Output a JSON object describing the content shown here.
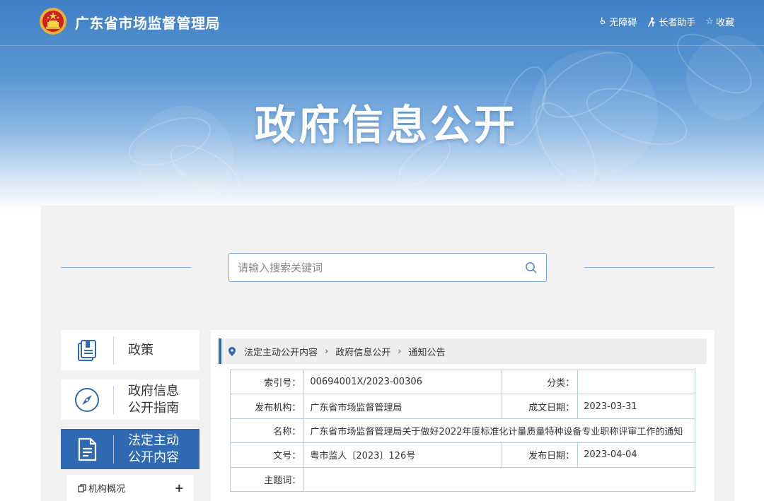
{
  "header": {
    "site_title": "广东省市场监督管理局",
    "links": [
      {
        "icon": "wheelchair-icon",
        "label": "无障碍"
      },
      {
        "icon": "elder-icon",
        "label": "长者助手"
      },
      {
        "icon": "star-icon",
        "label": "收藏"
      }
    ],
    "banner_title": "政府信息公开"
  },
  "search": {
    "placeholder": "请输入搜索关键词",
    "value": ""
  },
  "sidebar": {
    "items": [
      {
        "label": "政策",
        "icon": "book-icon",
        "active": false
      },
      {
        "label": "政府信息\n公开指南",
        "icon": "compass-icon",
        "active": false
      },
      {
        "label": "法定主动\n公开内容",
        "icon": "document-icon",
        "active": true
      }
    ],
    "sub_items": [
      {
        "label": "机构概况",
        "icon": "copy-icon",
        "expand": "+"
      }
    ]
  },
  "breadcrumb": {
    "items": [
      "法定主动公开内容",
      "政府信息公开",
      "通知公告"
    ]
  },
  "meta": {
    "index_label": "索引号：",
    "index_value": "00694001X/2023-00306",
    "category_label": "分类：",
    "category_value": "",
    "publisher_label": "发布机构：",
    "publisher_value": "广东省市场监督管理局",
    "created_label": "成文日期：",
    "created_value": "2023-03-31",
    "name_label": "名称：",
    "name_value": "广东省市场监督管理局关于做好2022年度标准化计量质量特种设备专业职称评审工作的通知",
    "docno_label": "文号：",
    "docno_value": "粤市监人〔2023〕126号",
    "published_label": "发布日期：",
    "published_value": "2023-04-04",
    "subject_label": "主题词：",
    "subject_value": ""
  },
  "colors": {
    "brand_blue": "#2f6ab3",
    "banner_blue": "#4a8bcd",
    "table_border": "#b7cde6",
    "panel_gray": "#f1f1f1"
  }
}
